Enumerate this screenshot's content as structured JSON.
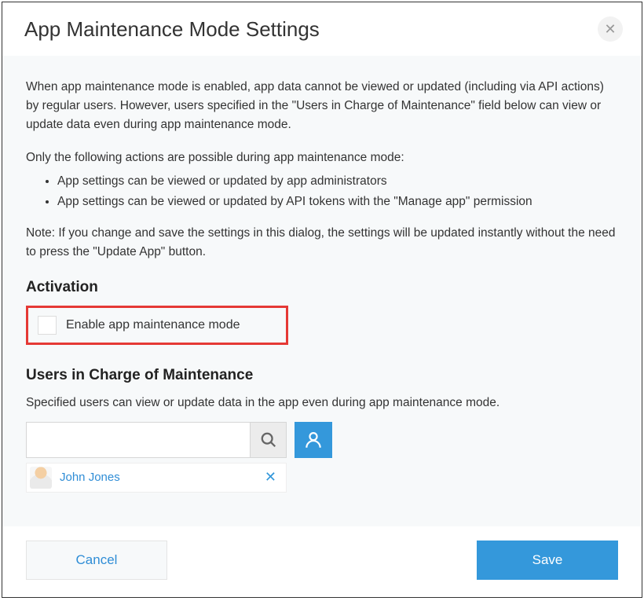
{
  "dialog": {
    "title": "App Maintenance Mode Settings"
  },
  "body": {
    "intro": "When app maintenance mode is enabled, app data cannot be viewed or updated (including via API actions) by regular users. However, users specified in the \"Users in Charge of Maintenance\" field below can view or update data even during app maintenance mode.",
    "allowed_intro": "Only the following actions are possible during app maintenance mode:",
    "bullets": [
      "App settings can be viewed or updated by app administrators",
      "App settings can be viewed or updated by API tokens with the \"Manage app\" permission"
    ],
    "note": "Note: If you change and save the settings in this dialog, the settings will be updated instantly without the need to press the \"Update App\" button.",
    "activation_heading": "Activation",
    "checkbox_label": "Enable app maintenance mode",
    "users_heading": "Users in Charge of Maintenance",
    "users_desc": "Specified users can view or update data in the app even during app maintenance mode.",
    "search_placeholder": "",
    "selected_user": "John Jones"
  },
  "footer": {
    "cancel": "Cancel",
    "save": "Save"
  }
}
